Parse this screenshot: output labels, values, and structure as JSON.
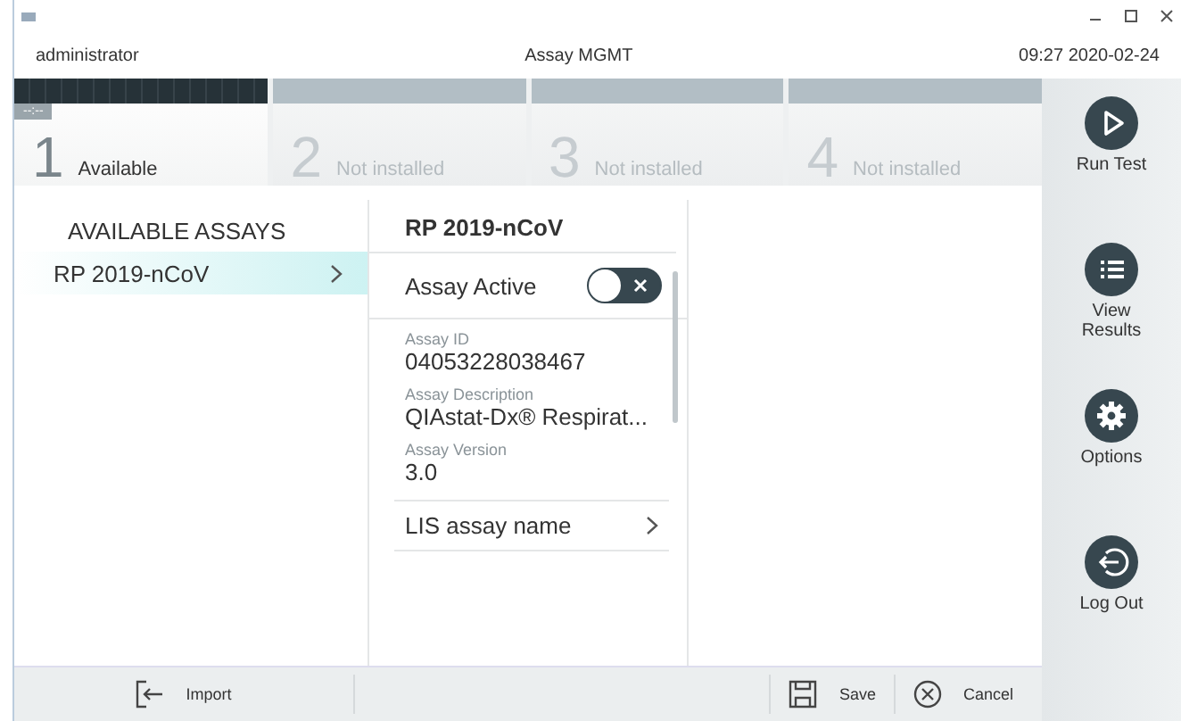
{
  "window": {
    "user": "administrator",
    "title": "Assay MGMT",
    "datetime": "09:27 2020-02-24"
  },
  "slots": [
    {
      "number": "1",
      "label": "Available",
      "timer": "--:--",
      "selected": true
    },
    {
      "number": "2",
      "label": "Not installed",
      "selected": false
    },
    {
      "number": "3",
      "label": "Not installed",
      "selected": false
    },
    {
      "number": "4",
      "label": "Not installed",
      "selected": false
    }
  ],
  "available_assays": {
    "title": "AVAILABLE ASSAYS",
    "items": [
      {
        "label": "RP 2019-nCoV",
        "selected": true
      }
    ]
  },
  "detail": {
    "title": "RP 2019-nCoV",
    "active_label": "Assay Active",
    "active": false,
    "fields": [
      {
        "label": "Assay ID",
        "value": "04053228038467"
      },
      {
        "label": "Assay Description",
        "value": "QIAstat-Dx® Respirat..."
      },
      {
        "label": "Assay Version",
        "value": "3.0"
      }
    ],
    "links": [
      "LIS assay name"
    ]
  },
  "sidebar": [
    {
      "kind": "run",
      "label": "Run Test"
    },
    {
      "kind": "results",
      "label": "View Results"
    },
    {
      "kind": "options",
      "label": "Options"
    },
    {
      "kind": "logout",
      "label": "Log Out"
    }
  ],
  "bottom_bar": {
    "import": "Import",
    "save": "Save",
    "cancel": "Cancel"
  }
}
